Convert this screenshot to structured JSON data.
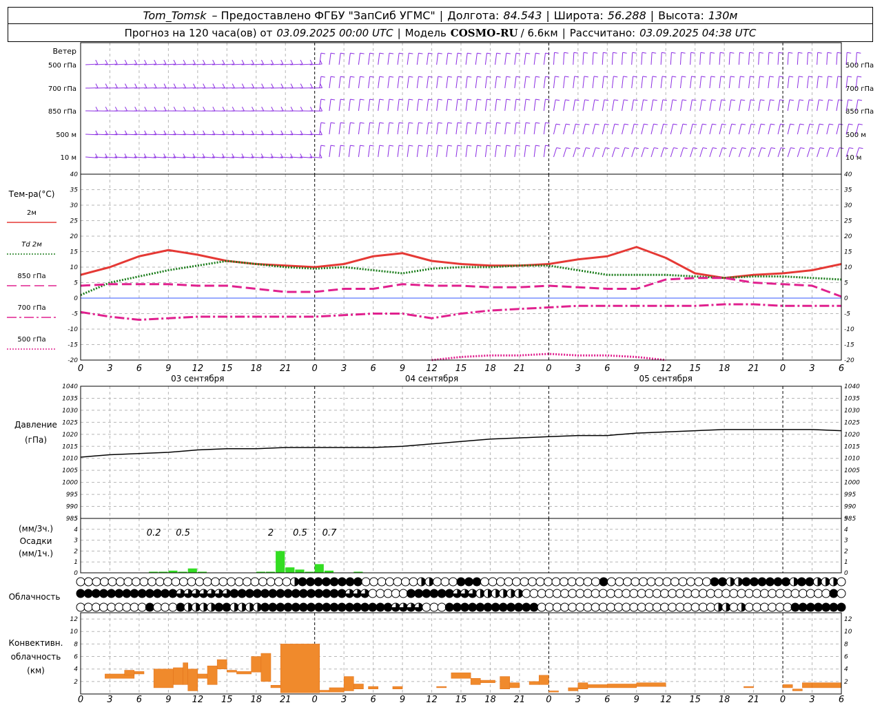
{
  "header": {
    "station": "Tom_Tomsk",
    "provider": "– Предоставлено ФГБУ \"ЗапСиб УГМС\"",
    "lon_label": "Долгота:",
    "lon": "84.543",
    "lat_label": "Широта:",
    "lat": "56.288",
    "alt_label": "Высота:",
    "alt": "130м",
    "forecast_prefix": "Прогноз на 120 часа(ов) от",
    "forecast_from": "03.09.2025 00:00 UTC",
    "model_label": "Модель",
    "model": "COSMO-RU",
    "model_res": "/ 6.6км",
    "calc_label": "Рассчитано:",
    "calc_time": "03.09.2025 04:38 UTC"
  },
  "chart_data": [
    {
      "type": "wind-barbs",
      "title": "Ветер",
      "levels": [
        "500 гПа",
        "700 гПа",
        "850 гПа",
        "500 м",
        "10 м"
      ],
      "color": "#8a2be2"
    },
    {
      "type": "line",
      "ylabel": "Тем-ра(°C)",
      "ylim": [
        -20,
        40
      ],
      "yticks": [
        -20,
        -15,
        -10,
        -5,
        0,
        5,
        10,
        15,
        20,
        25,
        30,
        35,
        40
      ],
      "x_hours": [
        0,
        3,
        6,
        9,
        12,
        15,
        18,
        21,
        24,
        27,
        30,
        33,
        36,
        39,
        42,
        45,
        48,
        51,
        54,
        57,
        60,
        63,
        66,
        69,
        72,
        75,
        78
      ],
      "series": [
        {
          "name": "2м",
          "color": "#e53935",
          "style": "solid",
          "values": [
            7.5,
            10,
            13.5,
            15.5,
            14,
            12,
            11,
            10.5,
            10,
            11,
            13.5,
            14.5,
            12,
            11,
            10.5,
            10.5,
            11,
            12.5,
            13.5,
            16.5,
            13,
            8,
            6.5,
            7.5,
            8,
            9,
            11
          ]
        },
        {
          "name": "Td 2м",
          "color": "#1b7d1b",
          "style": "dotted",
          "values": [
            1,
            5,
            7,
            9,
            10.5,
            12,
            11,
            10,
            9.5,
            10,
            9,
            8,
            9.5,
            10,
            10,
            10.5,
            10.5,
            9,
            7.5,
            7.5,
            7.5,
            7,
            6.5,
            7,
            7,
            6.5,
            6
          ]
        },
        {
          "name": "850 гПа",
          "color": "#e0208e",
          "style": "dashed",
          "values": [
            4,
            4.5,
            4.5,
            4.5,
            4,
            4,
            3,
            2,
            2,
            3,
            3,
            4.5,
            4,
            4,
            3.5,
            3.5,
            4,
            3.5,
            3,
            3,
            6,
            6.5,
            6.5,
            5,
            4.5,
            4,
            0.5
          ]
        },
        {
          "name": "700 гПа",
          "color": "#e0208e",
          "style": "dashdot",
          "values": [
            -4.5,
            -6,
            -7,
            -6.5,
            -6,
            -6,
            -6,
            -6,
            -6,
            -5.5,
            -5,
            -5,
            -6.5,
            -5,
            -4,
            -3.5,
            -3,
            -2.5,
            -2.5,
            -2.5,
            -2.5,
            -2.5,
            -2,
            -2,
            -2.5,
            -2.5,
            -2.5
          ]
        },
        {
          "name": "500 гПа",
          "color": "#e0208e",
          "style": "dotted",
          "values": [
            null,
            null,
            null,
            null,
            null,
            null,
            null,
            null,
            null,
            null,
            null,
            null,
            -20,
            -19,
            -18.5,
            -18.5,
            -18,
            -18.5,
            -18.5,
            -19,
            -20,
            null,
            null,
            null,
            null,
            null,
            null
          ]
        }
      ],
      "day_labels": [
        "03 сентября",
        "04 сентября",
        "05 сентября"
      ],
      "grid": true
    },
    {
      "type": "line",
      "ylabel": "Давление",
      "yunit": "(гПа)",
      "ylim": [
        985,
        1040
      ],
      "yticks": [
        985,
        990,
        995,
        1000,
        1005,
        1010,
        1015,
        1020,
        1025,
        1030,
        1035,
        1040
      ],
      "series": [
        {
          "name": "Давление",
          "color": "#000000",
          "x": [
            0,
            3,
            6,
            9,
            12,
            15,
            18,
            21,
            24,
            27,
            30,
            33,
            36,
            39,
            42,
            45,
            48,
            51,
            54,
            57,
            60,
            63,
            66,
            69,
            72,
            75,
            78
          ],
          "values": [
            1010.5,
            1011.5,
            1012,
            1012.5,
            1013.5,
            1014,
            1014,
            1014.5,
            1014.5,
            1014.5,
            1014.5,
            1015,
            1016,
            1017,
            1018,
            1018.5,
            1019,
            1019.5,
            1019.5,
            1020.5,
            1021,
            1021.5,
            1022,
            1022,
            1022,
            1022,
            1021.5
          ]
        }
      ],
      "grid": true
    },
    {
      "type": "bar",
      "ylabel": "Осадки",
      "units": [
        "(мм/3ч.)",
        "(мм/1ч.)"
      ],
      "ylim": [
        0,
        5
      ],
      "yticks": [
        0,
        1,
        2,
        3,
        4,
        5
      ],
      "color": "#33dd22",
      "x_hours": [
        7,
        8,
        9,
        10,
        11,
        12,
        18,
        19,
        20,
        21,
        22,
        23,
        24,
        25,
        28
      ],
      "values": [
        0.1,
        0.1,
        0.2,
        0.1,
        0.4,
        0.1,
        0.1,
        0.1,
        2,
        0.5,
        0.3,
        0.1,
        0.8,
        0.2,
        0.1
      ],
      "labels_3h": [
        {
          "hour": 7.5,
          "text": "0.2"
        },
        {
          "hour": 10.5,
          "text": "0.5"
        },
        {
          "hour": 19.5,
          "text": "2"
        },
        {
          "hour": 22.5,
          "text": "0.5"
        },
        {
          "hour": 25.5,
          "text": "0.7"
        }
      ],
      "grid": true
    },
    {
      "type": "cloud-symbols",
      "ylabel": "Облачность",
      "rows": [
        "upper",
        "middle",
        "low"
      ],
      "values": [
        "0000000000000000000000000002444444440000000220004440000000000000004000000000000044224444442442220",
        "4444444444444333333344444444444444433300000444444333222222000000000000000000000000000000000000000040",
        "0000000004000422224422224444444444444444433330004444444444440000000000000000000000022020000004444444"
      ]
    },
    {
      "type": "bar",
      "ylabel": "Конвективн. облачность (км)",
      "ylim": [
        0,
        13
      ],
      "yticks": [
        0,
        2,
        4,
        6,
        8,
        10,
        12
      ],
      "color": "#f08a2c",
      "segments": [
        [
          2.5,
          5.5,
          2.5,
          3.2
        ],
        [
          4.5,
          5.5,
          3.0,
          3.8
        ],
        [
          5.5,
          6.5,
          3.2,
          3.6
        ],
        [
          7.5,
          9.5,
          1.0,
          4.0
        ],
        [
          9.5,
          10.5,
          1.5,
          4.2
        ],
        [
          10.5,
          11,
          1.5,
          5.0
        ],
        [
          11,
          12,
          0.5,
          4.0
        ],
        [
          12,
          13,
          2.5,
          3.2
        ],
        [
          13,
          14,
          1.5,
          4.5
        ],
        [
          14,
          15,
          4.0,
          5.5
        ],
        [
          15,
          16,
          3.5,
          3.8
        ],
        [
          16,
          17.5,
          3.2,
          3.6
        ],
        [
          17.5,
          18.5,
          3.5,
          6.0
        ],
        [
          18.5,
          19.5,
          2.0,
          6.5
        ],
        [
          19.5,
          20.5,
          1.0,
          1.4
        ],
        [
          20.5,
          24.5,
          0.2,
          8.0
        ],
        [
          24.5,
          25.5,
          0.3,
          0.6
        ],
        [
          25.5,
          27,
          0.3,
          1.0
        ],
        [
          27,
          28,
          0.5,
          2.8
        ],
        [
          28,
          29,
          0.8,
          1.6
        ],
        [
          29.5,
          30.5,
          0.8,
          1.2
        ],
        [
          32,
          33,
          0.8,
          1.2
        ],
        [
          36.5,
          37.5,
          1.0,
          1.2
        ],
        [
          38,
          40,
          2.5,
          3.4
        ],
        [
          40,
          41,
          1.5,
          2.5
        ],
        [
          41,
          42.5,
          1.8,
          2.2
        ],
        [
          43,
          44,
          0.8,
          2.8
        ],
        [
          44,
          45,
          1.0,
          1.8
        ],
        [
          46,
          47,
          1.5,
          2.0
        ],
        [
          47,
          48,
          1.5,
          3.0
        ],
        [
          48,
          49,
          0.3,
          0.5
        ],
        [
          50,
          51,
          0.5,
          1.0
        ],
        [
          51,
          52,
          0.8,
          1.8
        ],
        [
          52,
          54,
          1.0,
          1.5
        ],
        [
          54,
          57,
          1.0,
          1.6
        ],
        [
          57,
          60,
          1.2,
          1.8
        ],
        [
          68,
          69,
          1.0,
          1.2
        ],
        [
          72,
          73,
          1.0,
          1.5
        ],
        [
          73,
          74,
          0.5,
          0.8
        ],
        [
          74,
          75,
          1.0,
          1.8
        ],
        [
          75,
          78,
          1.0,
          1.8
        ]
      ],
      "grid": true
    }
  ],
  "x_axis": {
    "tick_labels": [
      "0",
      "3",
      "6",
      "9",
      "12",
      "15",
      "18",
      "21",
      "0",
      "3",
      "6",
      "9",
      "12",
      "15",
      "18",
      "21",
      "0",
      "3",
      "6",
      "9",
      "12",
      "15",
      "18",
      "21",
      "0",
      "3",
      "6"
    ]
  }
}
